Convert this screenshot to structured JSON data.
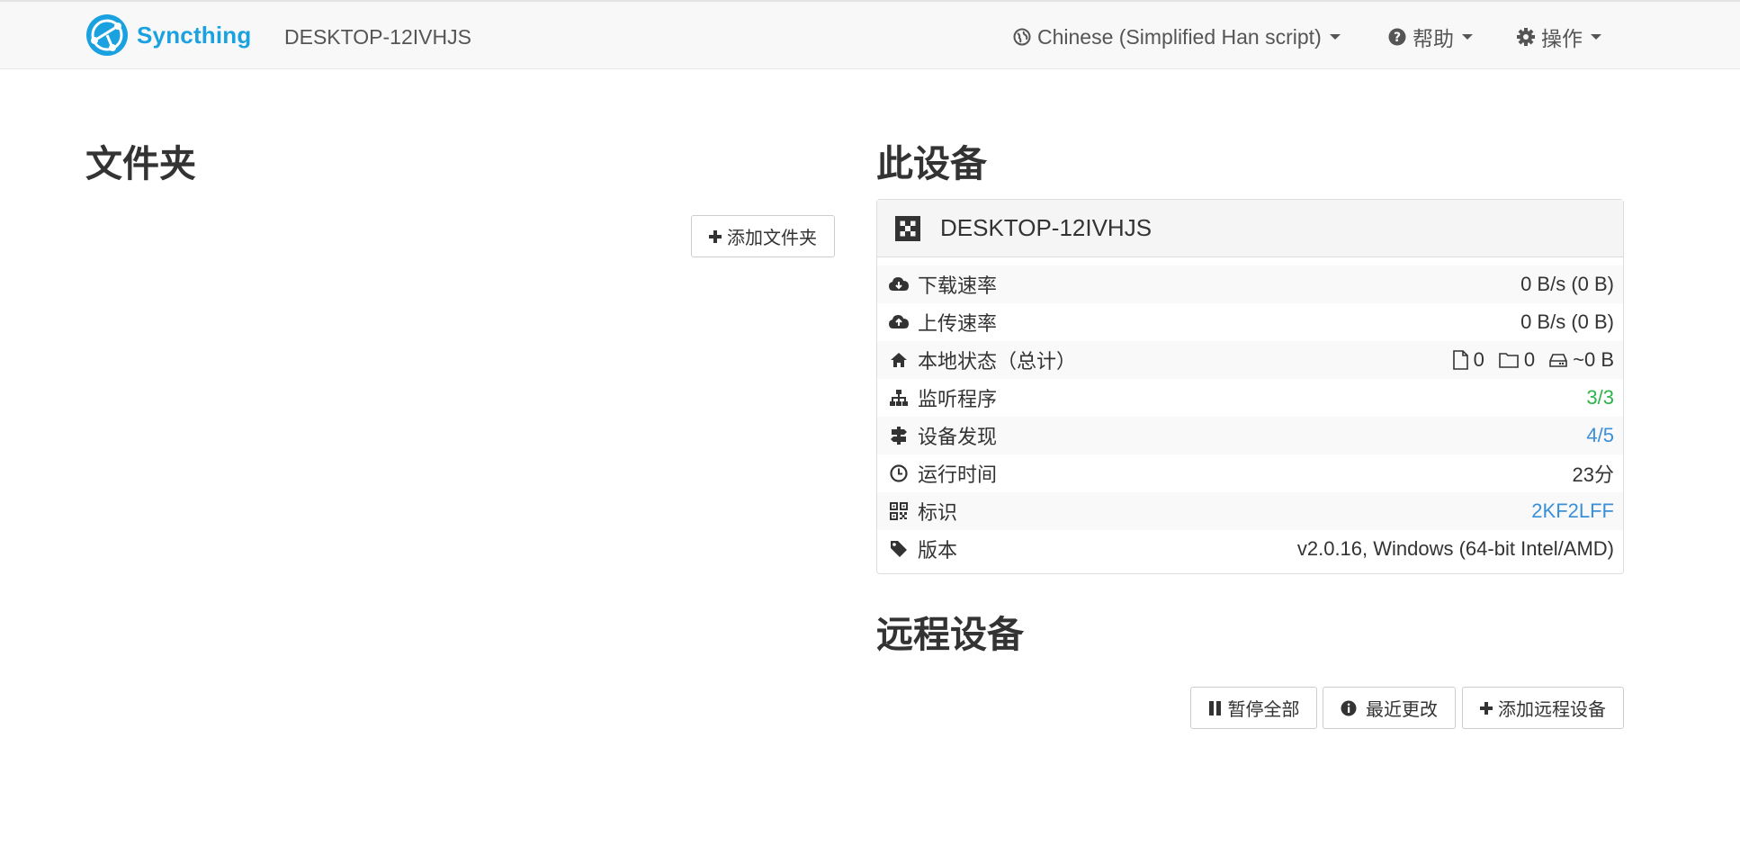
{
  "navbar": {
    "brand": "Syncthing",
    "device_name": "DESKTOP-12IVHJS",
    "language_label": "Chinese (Simplified Han script)",
    "help_label": "帮助",
    "actions_label": "操作"
  },
  "folders": {
    "heading": "文件夹",
    "add_button": "添加文件夹"
  },
  "this_device": {
    "heading": "此设备",
    "name": "DESKTOP-12IVHJS",
    "rows": [
      {
        "label": "下载速率",
        "value": "0 B/s (0 B)"
      },
      {
        "label": "上传速率",
        "value": "0 B/s (0 B)"
      },
      {
        "label": "本地状态（总计）",
        "files": "0",
        "dirs": "0",
        "size": "~0 B"
      },
      {
        "label": "监听程序",
        "value": "3/3"
      },
      {
        "label": "设备发现",
        "value": "4/5"
      },
      {
        "label": "运行时间",
        "value": "23分"
      },
      {
        "label": "标识",
        "value": "2KF2LFF"
      },
      {
        "label": "版本",
        "value": "v2.0.16, Windows (64-bit Intel/AMD)"
      }
    ]
  },
  "remote_devices": {
    "heading": "远程设备",
    "pause_all": "暂停全部",
    "recent_changes": "最近更改",
    "add_remote": "添加远程设备"
  },
  "colors": {
    "brand": "#1aa2e0",
    "listeners_ok": "#2cb349",
    "link": "#3a8fd9"
  }
}
